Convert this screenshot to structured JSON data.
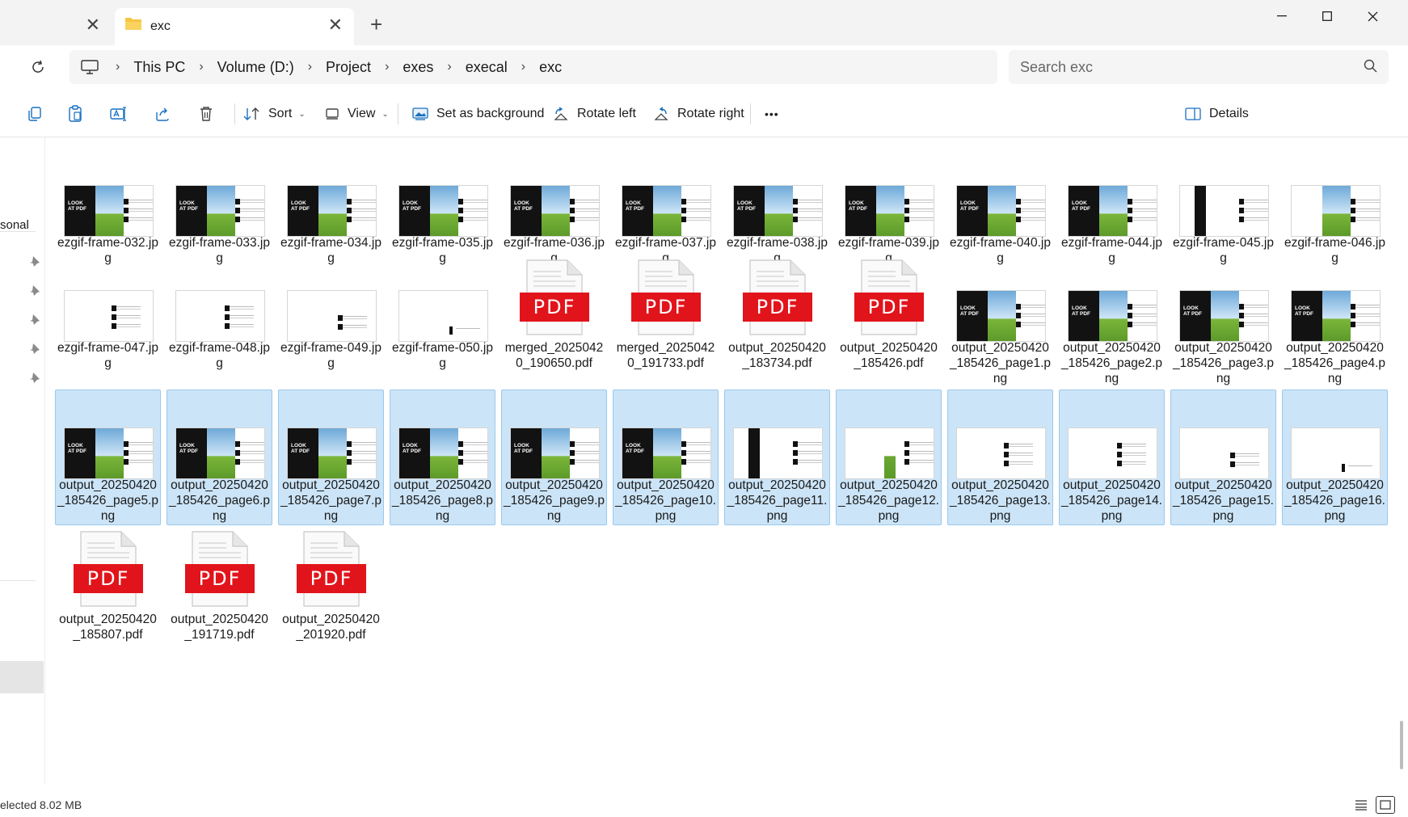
{
  "tabs": {
    "active_title": "exc",
    "new_tab_symbol": "+"
  },
  "address": {
    "crumbs": [
      "This PC",
      "Volume (D:)",
      "Project",
      "exes",
      "execal",
      "exc"
    ],
    "search_placeholder": "Search exc"
  },
  "toolbar": {
    "sort": "Sort",
    "view": "View",
    "set_background": "Set as background",
    "rotate_left": "Rotate left",
    "rotate_right": "Rotate right",
    "more": "•••",
    "details": "Details"
  },
  "nav": {
    "partial_label": "sonal"
  },
  "files": [
    {
      "name": "ezgif-frame-032.jpg",
      "type": "image",
      "variant": "full",
      "selected": false
    },
    {
      "name": "ezgif-frame-033.jpg",
      "type": "image",
      "variant": "full",
      "selected": false
    },
    {
      "name": "ezgif-frame-034.jpg",
      "type": "image",
      "variant": "full",
      "selected": false
    },
    {
      "name": "ezgif-frame-035.jpg",
      "type": "image",
      "variant": "full",
      "selected": false
    },
    {
      "name": "ezgif-frame-036.jpg",
      "type": "image",
      "variant": "full",
      "selected": false
    },
    {
      "name": "ezgif-frame-037.jpg",
      "type": "image",
      "variant": "full",
      "selected": false
    },
    {
      "name": "ezgif-frame-038.jpg",
      "type": "image",
      "variant": "full",
      "selected": false
    },
    {
      "name": "ezgif-frame-039.jpg",
      "type": "image",
      "variant": "full",
      "selected": false
    },
    {
      "name": "ezgif-frame-040.jpg",
      "type": "image",
      "variant": "full",
      "selected": false
    },
    {
      "name": "ezgif-frame-044.jpg",
      "type": "image",
      "variant": "full",
      "selected": false
    },
    {
      "name": "ezgif-frame-045.jpg",
      "type": "image",
      "variant": "narrow",
      "selected": false
    },
    {
      "name": "ezgif-frame-046.jpg",
      "type": "image",
      "variant": "skyonly",
      "selected": false
    },
    {
      "name": "ezgif-frame-047.jpg",
      "type": "image",
      "variant": "lines",
      "selected": false
    },
    {
      "name": "ezgif-frame-048.jpg",
      "type": "image",
      "variant": "lines2",
      "selected": false
    },
    {
      "name": "ezgif-frame-049.jpg",
      "type": "image",
      "variant": "lines3",
      "selected": false
    },
    {
      "name": "ezgif-frame-050.jpg",
      "type": "image",
      "variant": "blank",
      "selected": false
    },
    {
      "name": "merged_20250420_190650.pdf",
      "type": "pdf",
      "selected": false
    },
    {
      "name": "merged_20250420_191733.pdf",
      "type": "pdf",
      "selected": false
    },
    {
      "name": "output_20250420_183734.pdf",
      "type": "pdf",
      "selected": false
    },
    {
      "name": "output_20250420_185426.pdf",
      "type": "pdf",
      "selected": false
    },
    {
      "name": "output_20250420_185426_page1.png",
      "type": "image",
      "variant": "full",
      "selected": false
    },
    {
      "name": "output_20250420_185426_page2.png",
      "type": "image",
      "variant": "full",
      "selected": false
    },
    {
      "name": "output_20250420_185426_page3.png",
      "type": "image",
      "variant": "full",
      "selected": false
    },
    {
      "name": "output_20250420_185426_page4.png",
      "type": "image",
      "variant": "full",
      "selected": false
    },
    {
      "name": "output_20250420_185426_page5.png",
      "type": "image",
      "variant": "full",
      "selected": true
    },
    {
      "name": "output_20250420_185426_page6.png",
      "type": "image",
      "variant": "full",
      "selected": true
    },
    {
      "name": "output_20250420_185426_page7.png",
      "type": "image",
      "variant": "full",
      "selected": true
    },
    {
      "name": "output_20250420_185426_page8.png",
      "type": "image",
      "variant": "full",
      "selected": true
    },
    {
      "name": "output_20250420_185426_page9.png",
      "type": "image",
      "variant": "full",
      "selected": true
    },
    {
      "name": "output_20250420_185426_page10.png",
      "type": "image",
      "variant": "full",
      "selected": true
    },
    {
      "name": "output_20250420_185426_page11.png",
      "type": "image",
      "variant": "narrow",
      "selected": true
    },
    {
      "name": "output_20250420_185426_page12.png",
      "type": "image",
      "variant": "narrow2",
      "selected": true
    },
    {
      "name": "output_20250420_185426_page13.png",
      "type": "image",
      "variant": "lines",
      "selected": true
    },
    {
      "name": "output_20250420_185426_page14.png",
      "type": "image",
      "variant": "lines2",
      "selected": true
    },
    {
      "name": "output_20250420_185426_page15.png",
      "type": "image",
      "variant": "lines3",
      "selected": true
    },
    {
      "name": "output_20250420_185426_page16.png",
      "type": "image",
      "variant": "blank",
      "selected": true
    },
    {
      "name": "output_20250420_185807.pdf",
      "type": "pdf",
      "selected": false
    },
    {
      "name": "output_20250420_191719.pdf",
      "type": "pdf",
      "selected": false
    },
    {
      "name": "output_20250420_201920.pdf",
      "type": "pdf",
      "selected": false
    }
  ],
  "thumbnail_text": "LOOK AT PDF",
  "pdf_badge": "PDF",
  "status": {
    "text": "elected  8.02 MB"
  },
  "colors": {
    "selection_fill": "#cce4f7",
    "selection_border": "#99c9ef",
    "pdf_red": "#e2141b"
  }
}
